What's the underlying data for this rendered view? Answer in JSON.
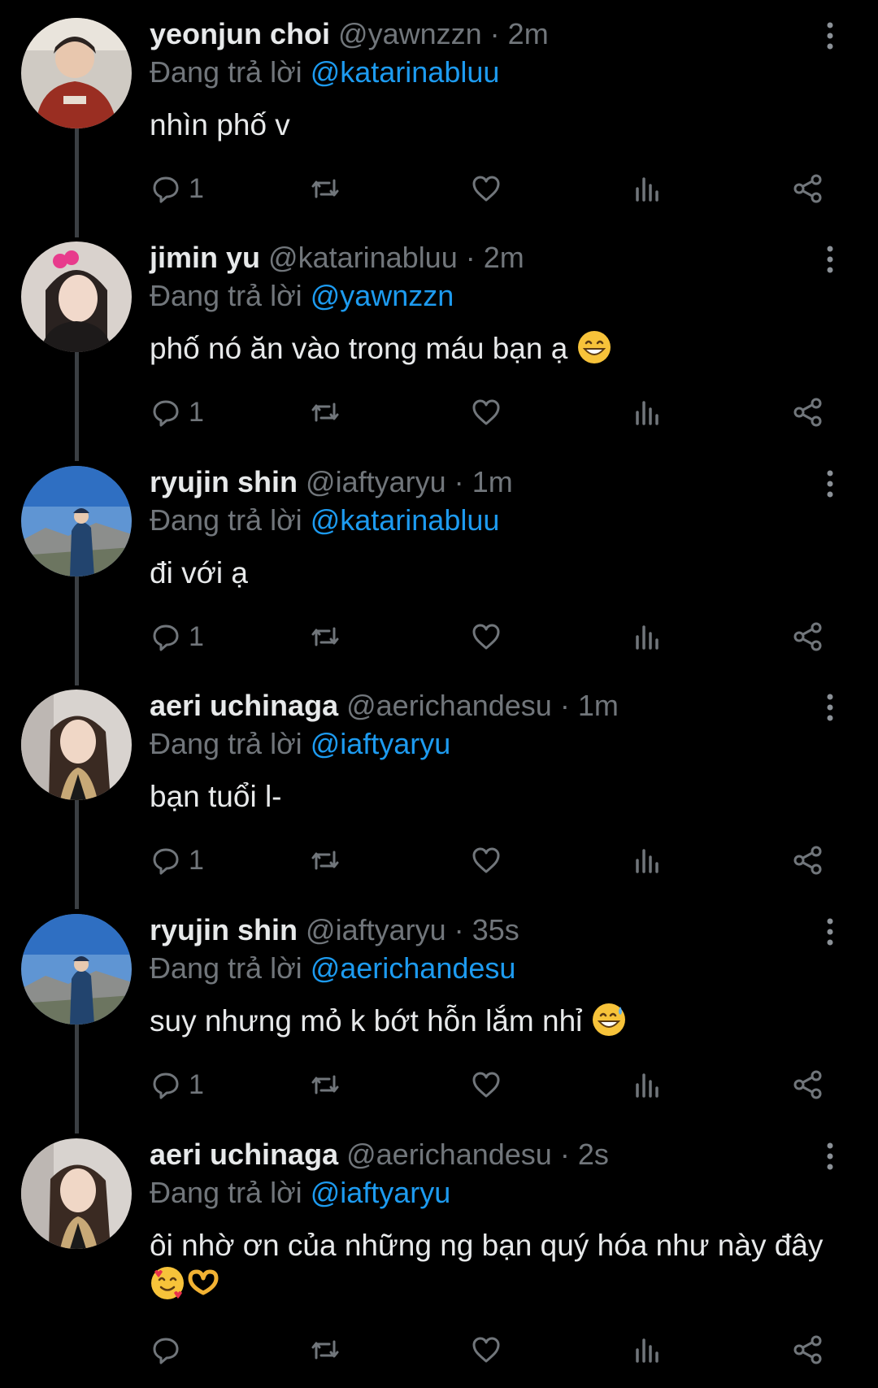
{
  "replying_label": "Đang trả lời",
  "tweets": [
    {
      "name": "yeonjun choi",
      "handle": "@yawnzzn",
      "time": "2m",
      "reply_to": "@katarinabluu",
      "text": "nhìn phố v",
      "reply_count": "1",
      "avatar": "red-hoodie-man",
      "emoji": ""
    },
    {
      "name": "jimin yu",
      "handle": "@katarinabluu",
      "time": "2m",
      "reply_to": "@yawnzzn",
      "text": "phố nó ăn vào trong máu bạn ạ",
      "reply_count": "1",
      "avatar": "woman-pink-bow",
      "emoji": "grinning-face"
    },
    {
      "name": "ryujin shin",
      "handle": "@iaftyaryu",
      "time": "1m",
      "reply_to": "@katarinabluu",
      "text": "đi với ạ",
      "reply_count": "1",
      "avatar": "mountain-sky",
      "emoji": ""
    },
    {
      "name": "aeri uchinaga",
      "handle": "@aerichandesu",
      "time": "1m",
      "reply_to": "@iaftyaryu",
      "text": "bạn tuổi l-",
      "reply_count": "1",
      "avatar": "woman-long-hair",
      "emoji": ""
    },
    {
      "name": "ryujin shin",
      "handle": "@iaftyaryu",
      "time": "35s",
      "reply_to": "@aerichandesu",
      "text": "suy nhưng mỏ k bớt hỗn lắm nhỉ",
      "reply_count": "1",
      "avatar": "mountain-sky",
      "emoji": "sweat-smile"
    },
    {
      "name": "aeri uchinaga",
      "handle": "@aerichandesu",
      "time": "2s",
      "reply_to": "@iaftyaryu",
      "text": "ôi nhờ ơn của những ng bạn quý hóa như này đây",
      "reply_count": "",
      "avatar": "woman-long-hair",
      "emoji": "hearts-face-heart-hands"
    }
  ],
  "colors": {
    "background": "#000000",
    "text": "#e7e9ea",
    "muted": "#71767b",
    "accent": "#1d9bf0"
  }
}
